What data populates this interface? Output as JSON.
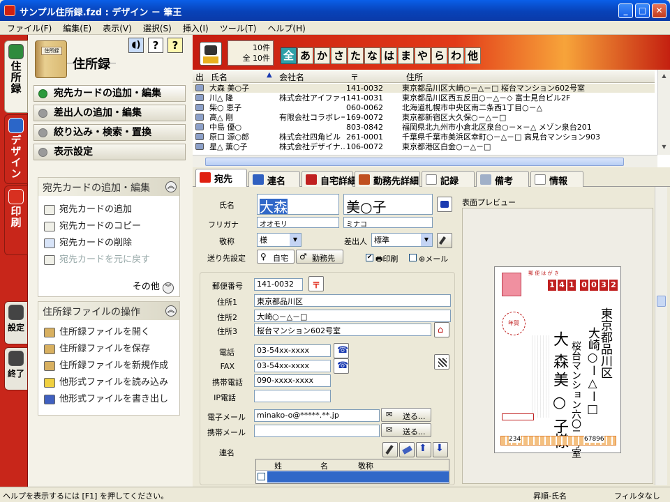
{
  "window": {
    "title": "サンプル住所録.fzd : デザイン － 筆王"
  },
  "menu": [
    "ファイル(F)",
    "編集(E)",
    "表示(V)",
    "選択(S)",
    "挿入(I)",
    "ツール(T)",
    "ヘルプ(H)"
  ],
  "vtabs": [
    {
      "label": "住所録",
      "color": "#2e8b3c"
    },
    {
      "label": "デザイン",
      "color": "#2b66c8"
    },
    {
      "label": "印刷",
      "color": "#d83020"
    },
    {
      "label": "設定",
      "color": "#444444"
    },
    {
      "label": "終了",
      "color": "#444444"
    }
  ],
  "left": {
    "header": "住所録",
    "book_label": "住所録",
    "nav": [
      "宛先カードの追加・編集",
      "差出人の追加・編集",
      "絞り込み・検索・置換",
      "表示設定"
    ],
    "pane1": {
      "title": "宛先カードの追加・編集",
      "items": [
        "宛先カードの追加",
        "宛先カードのコピー",
        "宛先カードの削除",
        "宛先カードを元に戻す"
      ],
      "more": "その他"
    },
    "pane2": {
      "title": "住所録ファイルの操作",
      "items": [
        "住所録ファイルを開く",
        "住所録ファイルを保存",
        "住所録ファイルを新規作成",
        "他形式ファイルを読み込み",
        "他形式ファイルを書き出し"
      ]
    }
  },
  "filter": {
    "count": "10件",
    "total": "全 10件",
    "kana": [
      "全",
      "あ",
      "か",
      "さ",
      "た",
      "な",
      "は",
      "ま",
      "や",
      "ら",
      "わ",
      "他"
    ]
  },
  "list": {
    "headers": [
      "出",
      "氏名",
      "会社名",
      "〒",
      "住所"
    ],
    "rows": [
      [
        "大森 美○子",
        "",
        "141-0032",
        "東京都品川区大崎○－△－□ 桜台マンション602号室"
      ],
      [
        "川△ 隆",
        "株式会社アイファイブ",
        "141-0031",
        "東京都品川区西五反田○－△－◇ 富士見台ビル2F"
      ],
      [
        "柴○ 恵子",
        "",
        "060-0062",
        "北海道札幌市中央区南二条西1丁目○－△"
      ],
      [
        "高△ 剛",
        "有限会社コラボレー...",
        "169-0072",
        "東京都新宿区大久保○－△－□"
      ],
      [
        "中島 優○",
        "",
        "803-0842",
        "福岡県北九州市小倉北区泉台○－×－△ メゾン泉台201"
      ],
      [
        "原口 源○郎",
        "株式会社四角ビル",
        "261-0001",
        "千葉県千葉市美浜区幸町○－△－□ 高見台マンション903"
      ],
      [
        "星△ 薫○子",
        "株式会社デザイナ...",
        "106-0072",
        "東京都港区白金○－△－□"
      ]
    ]
  },
  "tabs": [
    "宛先",
    "連名",
    "自宅詳細",
    "勤務先詳細",
    "記録",
    "備考",
    "情報"
  ],
  "form": {
    "name_label": "氏名",
    "last": "大森",
    "first": "美○子",
    "furi_label": "フリガナ",
    "furi_last": "オオモリ",
    "furi_first": "ミナコ",
    "honor_label": "敬称",
    "honor": "様",
    "sender_label": "差出人",
    "sender": "標準",
    "dest_label": "送り先設定",
    "home": "自宅",
    "work": "勤務先",
    "print_label": "印刷",
    "mail_label": "メール",
    "zip_label": "郵便番号",
    "zip": "141-0032",
    "addr1_label": "住所1",
    "addr1": "東京都品川区",
    "addr2_label": "住所2",
    "addr2": "大崎○－△－□",
    "addr3_label": "住所3",
    "addr3": "桜台マンション602号室",
    "tel_label": "電話",
    "tel": "03-54xx-xxxx",
    "fax_label": "FAX",
    "fax": "03-54xx-xxxx",
    "mobile_label": "携帯電話",
    "mobile": "090-xxxx-xxxx",
    "ip_label": "IP電話",
    "ip": "",
    "email_label": "電子メール",
    "email": "minako-o@*****.**.jp",
    "mmail_label": "携帯メール",
    "mmail": "",
    "send_label": "送る...",
    "renmei_label": "連名",
    "grid_headers": [
      "姓",
      "名",
      "敬称"
    ]
  },
  "preview": {
    "label": "表面プレビュー",
    "zip_digits": [
      "1",
      "4",
      "1",
      "0",
      "0",
      "3",
      "2"
    ],
    "addr_line1": "東京都品川区",
    "addr_line2": "大崎○ー△ー□",
    "addr_line3": "桜台マンション六〇二号室",
    "name_last": "大森",
    "name_first": "美○子",
    "honor": "様",
    "stamp": "年賀",
    "bottom_left": "234",
    "bottom_right": "67896"
  },
  "status": {
    "help": "ヘルプを表示するには [F1] を押してください。",
    "sort": "昇順-氏名",
    "filter": "フィルタなし"
  }
}
